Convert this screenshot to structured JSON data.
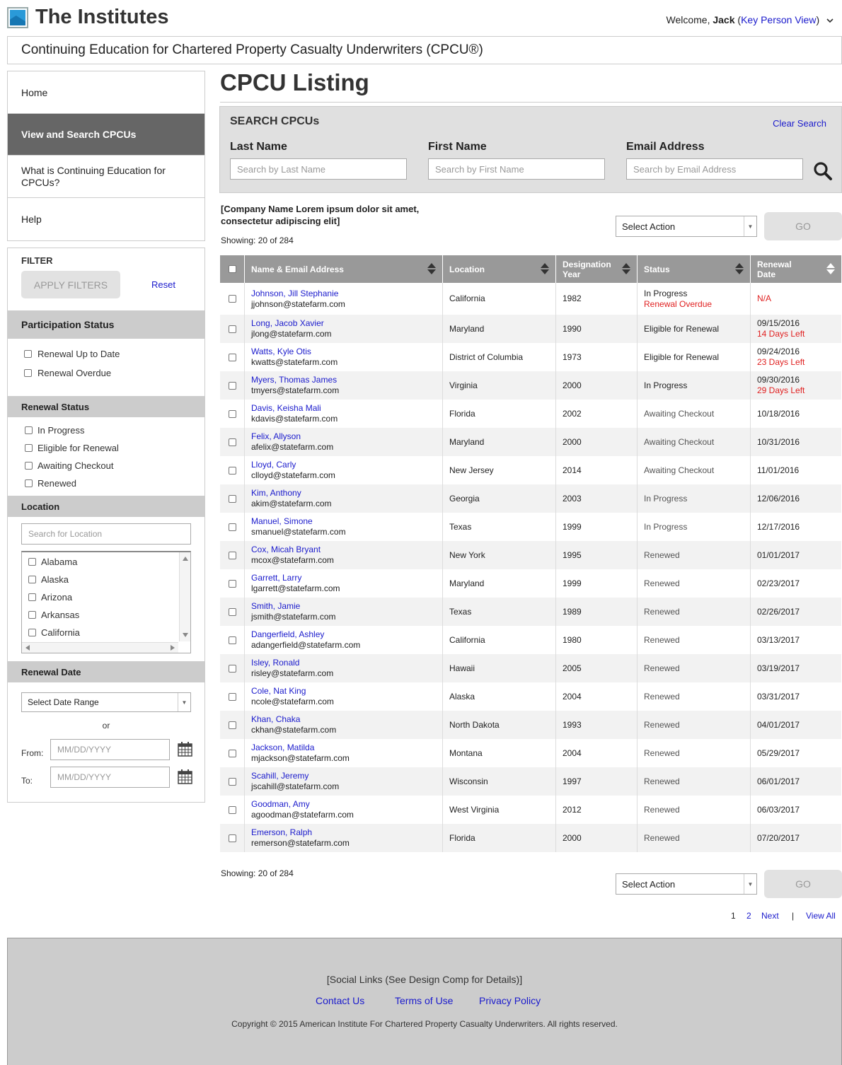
{
  "header": {
    "brand": "The Institutes",
    "welcome_prefix": "Welcome,",
    "user": "Jack",
    "view_link": "Key Person View",
    "banner": "Continuing Education for Chartered Property Casualty Underwriters (CPCU®)"
  },
  "nav": {
    "items": [
      {
        "label": "Home"
      },
      {
        "label": "View and Search CPCUs"
      },
      {
        "label": "What is Continuing Education for CPCUs?"
      },
      {
        "label": "Help"
      }
    ]
  },
  "filter": {
    "title": "FILTER",
    "apply": "APPLY FILTERS",
    "reset": "Reset",
    "participation": {
      "title": "Participation Status",
      "options": [
        "Renewal Up to Date",
        "Renewal Overdue"
      ]
    },
    "renewal_status": {
      "title": "Renewal Status",
      "options": [
        "In Progress",
        "Eligible for Renewal",
        "Awaiting Checkout",
        "Renewed"
      ]
    },
    "location": {
      "title": "Location",
      "placeholder": "Search for Location",
      "options": [
        "Alabama",
        "Alaska",
        "Arizona",
        "Arkansas",
        "California"
      ]
    },
    "renewal_date": {
      "title": "Renewal Date",
      "select": "Select Date Range",
      "or": "or",
      "from": "From:",
      "to": "To:",
      "date_placeholder": "MM/DD/YYYY"
    }
  },
  "main": {
    "title": "CPCU Listing",
    "search": {
      "title": "SEARCH CPCUs",
      "clear": "Clear Search",
      "last_label": "Last Name",
      "last_placeholder": "Search by Last Name",
      "first_label": "First Name",
      "first_placeholder": "Search by First Name",
      "email_label": "Email Address",
      "email_placeholder": "Search by Email Address"
    },
    "company_line1": "[Company Name Lorem ipsum dolor sit amet,",
    "company_line2": "consectetur adipiscing elit]",
    "showing": "Showing: 20 of 284",
    "select_action": "Select Action",
    "go": "GO",
    "columns": [
      "Name & Email Address",
      "Location",
      "Designation Year",
      "Status",
      "Renewal Date"
    ],
    "rows": [
      {
        "name": "Johnson, Jill Stephanie",
        "email": "jjohnson@statefarm.com",
        "location": "California",
        "year": "1982",
        "status": "In Progress",
        "status2": "Renewal Overdue",
        "date": "N/A",
        "date2": ""
      },
      {
        "name": "Long, Jacob Xavier",
        "email": "jlong@statefarm.com",
        "location": "Maryland",
        "year": "1990",
        "status": "Eligible for Renewal",
        "status2": "",
        "date": "09/15/2016",
        "date2": "14 Days Left"
      },
      {
        "name": "Watts, Kyle Otis",
        "email": "kwatts@statefarm.com",
        "location": "District of Columbia",
        "year": "1973",
        "status": "Eligible for Renewal",
        "status2": "",
        "date": "09/24/2016",
        "date2": "23 Days Left"
      },
      {
        "name": "Myers, Thomas James",
        "email": "tmyers@statefarm.com",
        "location": "Virginia",
        "year": "2000",
        "status": "In Progress",
        "status2": "",
        "date": "09/30/2016",
        "date2": "29 Days Left"
      },
      {
        "name": "Davis, Keisha Mali",
        "email": "kdavis@statefarm.com",
        "location": "Florida",
        "year": "2002",
        "status": "Awaiting Checkout",
        "status2": "",
        "date": "10/18/2016",
        "date2": ""
      },
      {
        "name": "Felix, Allyson",
        "email": "afelix@statefarm.com",
        "location": "Maryland",
        "year": "2000",
        "status": "Awaiting Checkout",
        "status2": "",
        "date": "10/31/2016",
        "date2": ""
      },
      {
        "name": "Lloyd, Carly",
        "email": "clloyd@statefarm.com",
        "location": "New Jersey",
        "year": "2014",
        "status": "Awaiting Checkout",
        "status2": "",
        "date": "11/01/2016",
        "date2": ""
      },
      {
        "name": "Kim, Anthony",
        "email": "akim@statefarm.com",
        "location": "Georgia",
        "year": "2003",
        "status": "In Progress",
        "status2": "",
        "date": "12/06/2016",
        "date2": ""
      },
      {
        "name": "Manuel, Simone",
        "email": "smanuel@statefarm.com",
        "location": "Texas",
        "year": "1999",
        "status": "In Progress",
        "status2": "",
        "date": "12/17/2016",
        "date2": ""
      },
      {
        "name": "Cox, Micah Bryant",
        "email": "mcox@statefarm.com",
        "location": "New York",
        "year": "1995",
        "status": "Renewed",
        "status2": "",
        "date": "01/01/2017",
        "date2": ""
      },
      {
        "name": "Garrett, Larry",
        "email": "lgarrett@statefarm.com",
        "location": "Maryland",
        "year": "1999",
        "status": "Renewed",
        "status2": "",
        "date": "02/23/2017",
        "date2": ""
      },
      {
        "name": "Smith, Jamie",
        "email": "jsmith@statefarm.com",
        "location": "Texas",
        "year": "1989",
        "status": "Renewed",
        "status2": "",
        "date": "02/26/2017",
        "date2": ""
      },
      {
        "name": "Dangerfield, Ashley",
        "email": "adangerfield@statefarm.com",
        "location": "California",
        "year": "1980",
        "status": "Renewed",
        "status2": "",
        "date": "03/13/2017",
        "date2": ""
      },
      {
        "name": "Isley, Ronald",
        "email": "risley@statefarm.com",
        "location": "Hawaii",
        "year": "2005",
        "status": "Renewed",
        "status2": "",
        "date": "03/19/2017",
        "date2": ""
      },
      {
        "name": "Cole, Nat King",
        "email": "ncole@statefarm.com",
        "location": "Alaska",
        "year": "2004",
        "status": "Renewed",
        "status2": "",
        "date": "03/31/2017",
        "date2": ""
      },
      {
        "name": "Khan, Chaka",
        "email": "ckhan@statefarm.com",
        "location": "North Dakota",
        "year": "1993",
        "status": "Renewed",
        "status2": "",
        "date": "04/01/2017",
        "date2": ""
      },
      {
        "name": "Jackson, Matilda",
        "email": "mjackson@statefarm.com",
        "location": "Montana",
        "year": "2004",
        "status": "Renewed",
        "status2": "",
        "date": "05/29/2017",
        "date2": ""
      },
      {
        "name": "Scahill, Jeremy",
        "email": "jscahill@statefarm.com",
        "location": "Wisconsin",
        "year": "1997",
        "status": "Renewed",
        "status2": "",
        "date": "06/01/2017",
        "date2": ""
      },
      {
        "name": "Goodman, Amy",
        "email": "agoodman@statefarm.com",
        "location": "West Virginia",
        "year": "2012",
        "status": "Renewed",
        "status2": "",
        "date": "06/03/2017",
        "date2": ""
      },
      {
        "name": "Emerson, Ralph",
        "email": "remerson@statefarm.com",
        "location": "Florida",
        "year": "2000",
        "status": "Renewed",
        "status2": "",
        "date": "07/20/2017",
        "date2": ""
      }
    ],
    "pagination": {
      "p1": "1",
      "p2": "2",
      "next": "Next",
      "sep": "|",
      "view_all": "View All"
    }
  },
  "footer": {
    "social": "[Social Links (See Design Comp for Details)]",
    "links": [
      "Contact Us",
      "Terms of Use",
      "Privacy Policy"
    ],
    "copyright": "Copyright © 2015 American Institute For Chartered Property Casualty Underwriters. All rights reserved."
  }
}
